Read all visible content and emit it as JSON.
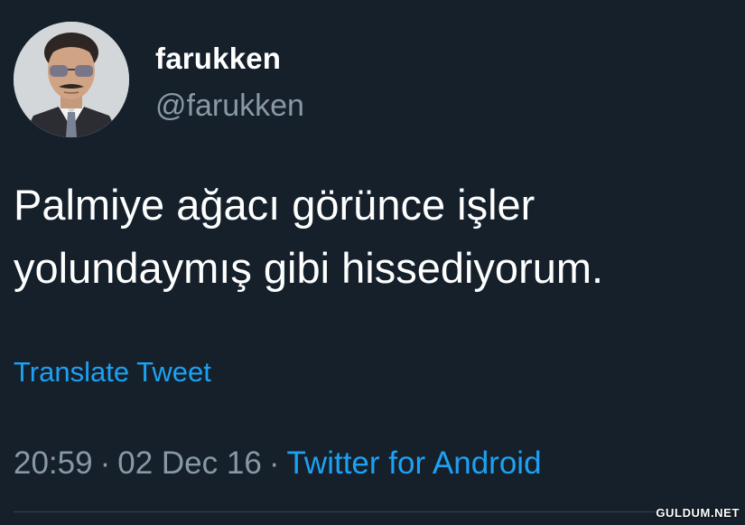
{
  "user": {
    "display_name": "farukken",
    "handle": "@farukken",
    "avatar_icon": "profile-photo"
  },
  "tweet": {
    "text_line1": "Palmiye ağacı görünce işler",
    "text_line2": "yolundaymış gibi hissediyorum.",
    "translate_label": "Translate Tweet"
  },
  "meta": {
    "time": "20:59",
    "separator": "·",
    "date": "02 Dec 16",
    "source": "Twitter for Android"
  },
  "watermark": "GULDUM.NET",
  "colors": {
    "background": "#15202b",
    "text": "#ffffff",
    "secondary": "#8899a6",
    "accent": "#1da1f2"
  }
}
